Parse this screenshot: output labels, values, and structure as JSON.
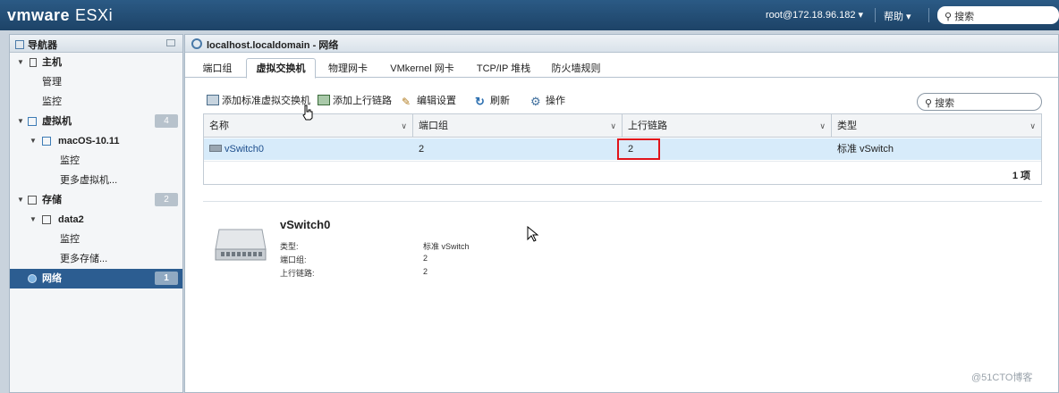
{
  "app": {
    "brand": "vmware",
    "product": "ESXi"
  },
  "topbar": {
    "user": "root@172.18.96.182 ▾",
    "help": "帮助 ▾",
    "search_placeholder": "搜索"
  },
  "navigator": {
    "title": "导航器",
    "items": [
      {
        "label": "主机",
        "level": 0,
        "icon": "host-icon"
      },
      {
        "label": "管理",
        "level": 1
      },
      {
        "label": "监控",
        "level": 1
      },
      {
        "label": "虚拟机",
        "level": 0,
        "icon": "vm-icon",
        "badge": "4"
      },
      {
        "label": "macOS-10.11",
        "level": 1,
        "icon": "vm-icon"
      },
      {
        "label": "监控",
        "level": 2
      },
      {
        "label": "更多虚拟机...",
        "level": 2
      },
      {
        "label": "存储",
        "level": 0,
        "icon": "storage-icon",
        "badge": "2"
      },
      {
        "label": "data2",
        "level": 1,
        "icon": "datastore-icon"
      },
      {
        "label": "监控",
        "level": 2
      },
      {
        "label": "更多存储...",
        "level": 2
      },
      {
        "label": "网络",
        "level": 0,
        "icon": "network-icon",
        "badge": "1",
        "selected": true
      }
    ]
  },
  "content": {
    "title": "localhost.localdomain - 网络",
    "tabs": [
      "端口组",
      "虚拟交换机",
      "物理网卡",
      "VMkernel 网卡",
      "TCP/IP 堆栈",
      "防火墙规则"
    ],
    "active_tab": "虚拟交换机",
    "toolbar": {
      "add_standard_vswitch": "添加标准虚拟交换机",
      "add_uplink": "添加上行链路",
      "edit_settings": "编辑设置",
      "refresh": "刷新",
      "actions": "操作"
    },
    "search_placeholder": "搜索",
    "grid": {
      "columns": [
        "名称",
        "端口组",
        "上行链路",
        "类型"
      ],
      "rows": [
        {
          "name": "vSwitch0",
          "portgroups": "2",
          "uplinks": "2",
          "type": "标准 vSwitch"
        }
      ],
      "footer": "1 项"
    },
    "detail": {
      "title": "vSwitch0",
      "fields": [
        {
          "label": "类型:",
          "value": "标准 vSwitch"
        },
        {
          "label": "端口组:",
          "value": "2"
        },
        {
          "label": "上行链路:",
          "value": "2"
        }
      ]
    }
  },
  "watermark": "@51CTO博客",
  "colors": {
    "topbar": "#1d4367",
    "selection": "#2c5d91",
    "row_highlight": "#d7ebfa",
    "annotation_box": "#e0141b"
  }
}
